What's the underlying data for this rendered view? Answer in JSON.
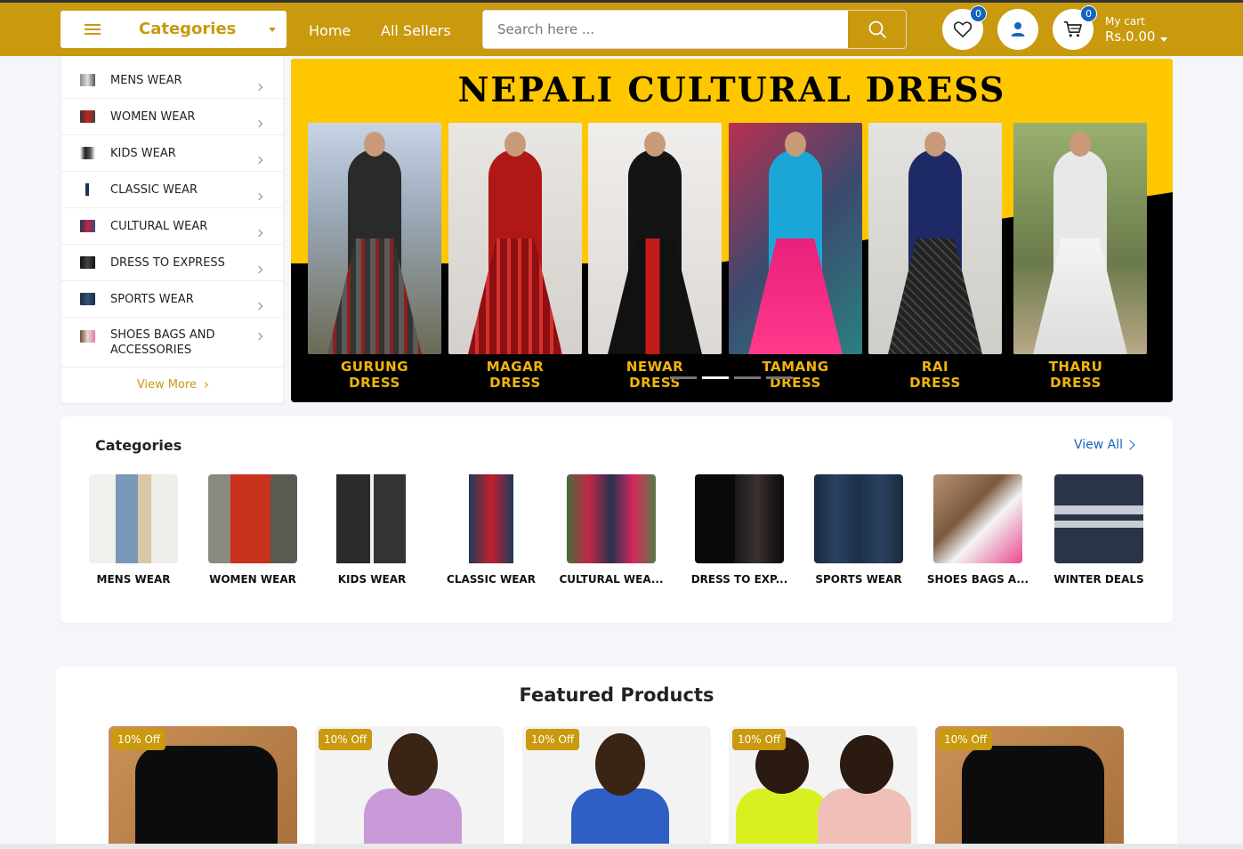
{
  "header": {
    "categories_label": "Categories",
    "nav": [
      {
        "label": "Home"
      },
      {
        "label": "All Sellers"
      }
    ],
    "search_placeholder": "Search here ...",
    "wishlist_count": "0",
    "cart_count": "0",
    "cart_label": "My cart",
    "cart_amount": "Rs.0.00",
    "accent_color": "#c9990e",
    "badge_color": "#1565c0"
  },
  "sidebar": {
    "items": [
      {
        "label": "MENS WEAR"
      },
      {
        "label": "WOMEN WEAR"
      },
      {
        "label": "KIDS WEAR"
      },
      {
        "label": "CLASSIC WEAR"
      },
      {
        "label": "CULTURAL WEAR"
      },
      {
        "label": "DRESS TO EXPRESS"
      },
      {
        "label": "SPORTS WEAR"
      },
      {
        "label": "SHOES BAGS AND ACCESSORIES"
      }
    ],
    "view_more": "View More"
  },
  "banner": {
    "title": "NEPALI CULTURAL DRESS",
    "dresses": [
      {
        "line1": "GURUNG",
        "line2": "DRESS"
      },
      {
        "line1": "MAGAR",
        "line2": "DRESS"
      },
      {
        "line1": "NEWAR",
        "line2": "DRESS"
      },
      {
        "line1": "TAMANG",
        "line2": "DRESS"
      },
      {
        "line1": "RAI",
        "line2": "DRESS"
      },
      {
        "line1": "THARU",
        "line2": "DRESS"
      }
    ],
    "active_slide": 2,
    "slide_count": 4
  },
  "categories": {
    "title": "Categories",
    "view_all": "View All",
    "items": [
      {
        "name": "MENS WEAR"
      },
      {
        "name": "WOMEN WEAR"
      },
      {
        "name": "KIDS WEAR"
      },
      {
        "name": "CLASSIC WEAR"
      },
      {
        "name": "CULTURAL WEA..."
      },
      {
        "name": "DRESS TO EXP..."
      },
      {
        "name": "SPORTS WEAR"
      },
      {
        "name": "SHOES BAGS A..."
      },
      {
        "name": "WINTER DEALS"
      }
    ]
  },
  "featured": {
    "title": "Featured Products",
    "products": [
      {
        "discount": "10% Off"
      },
      {
        "discount": "10% Off"
      },
      {
        "discount": "10% Off"
      },
      {
        "discount": "10% Off"
      },
      {
        "discount": "10% Off"
      }
    ]
  }
}
